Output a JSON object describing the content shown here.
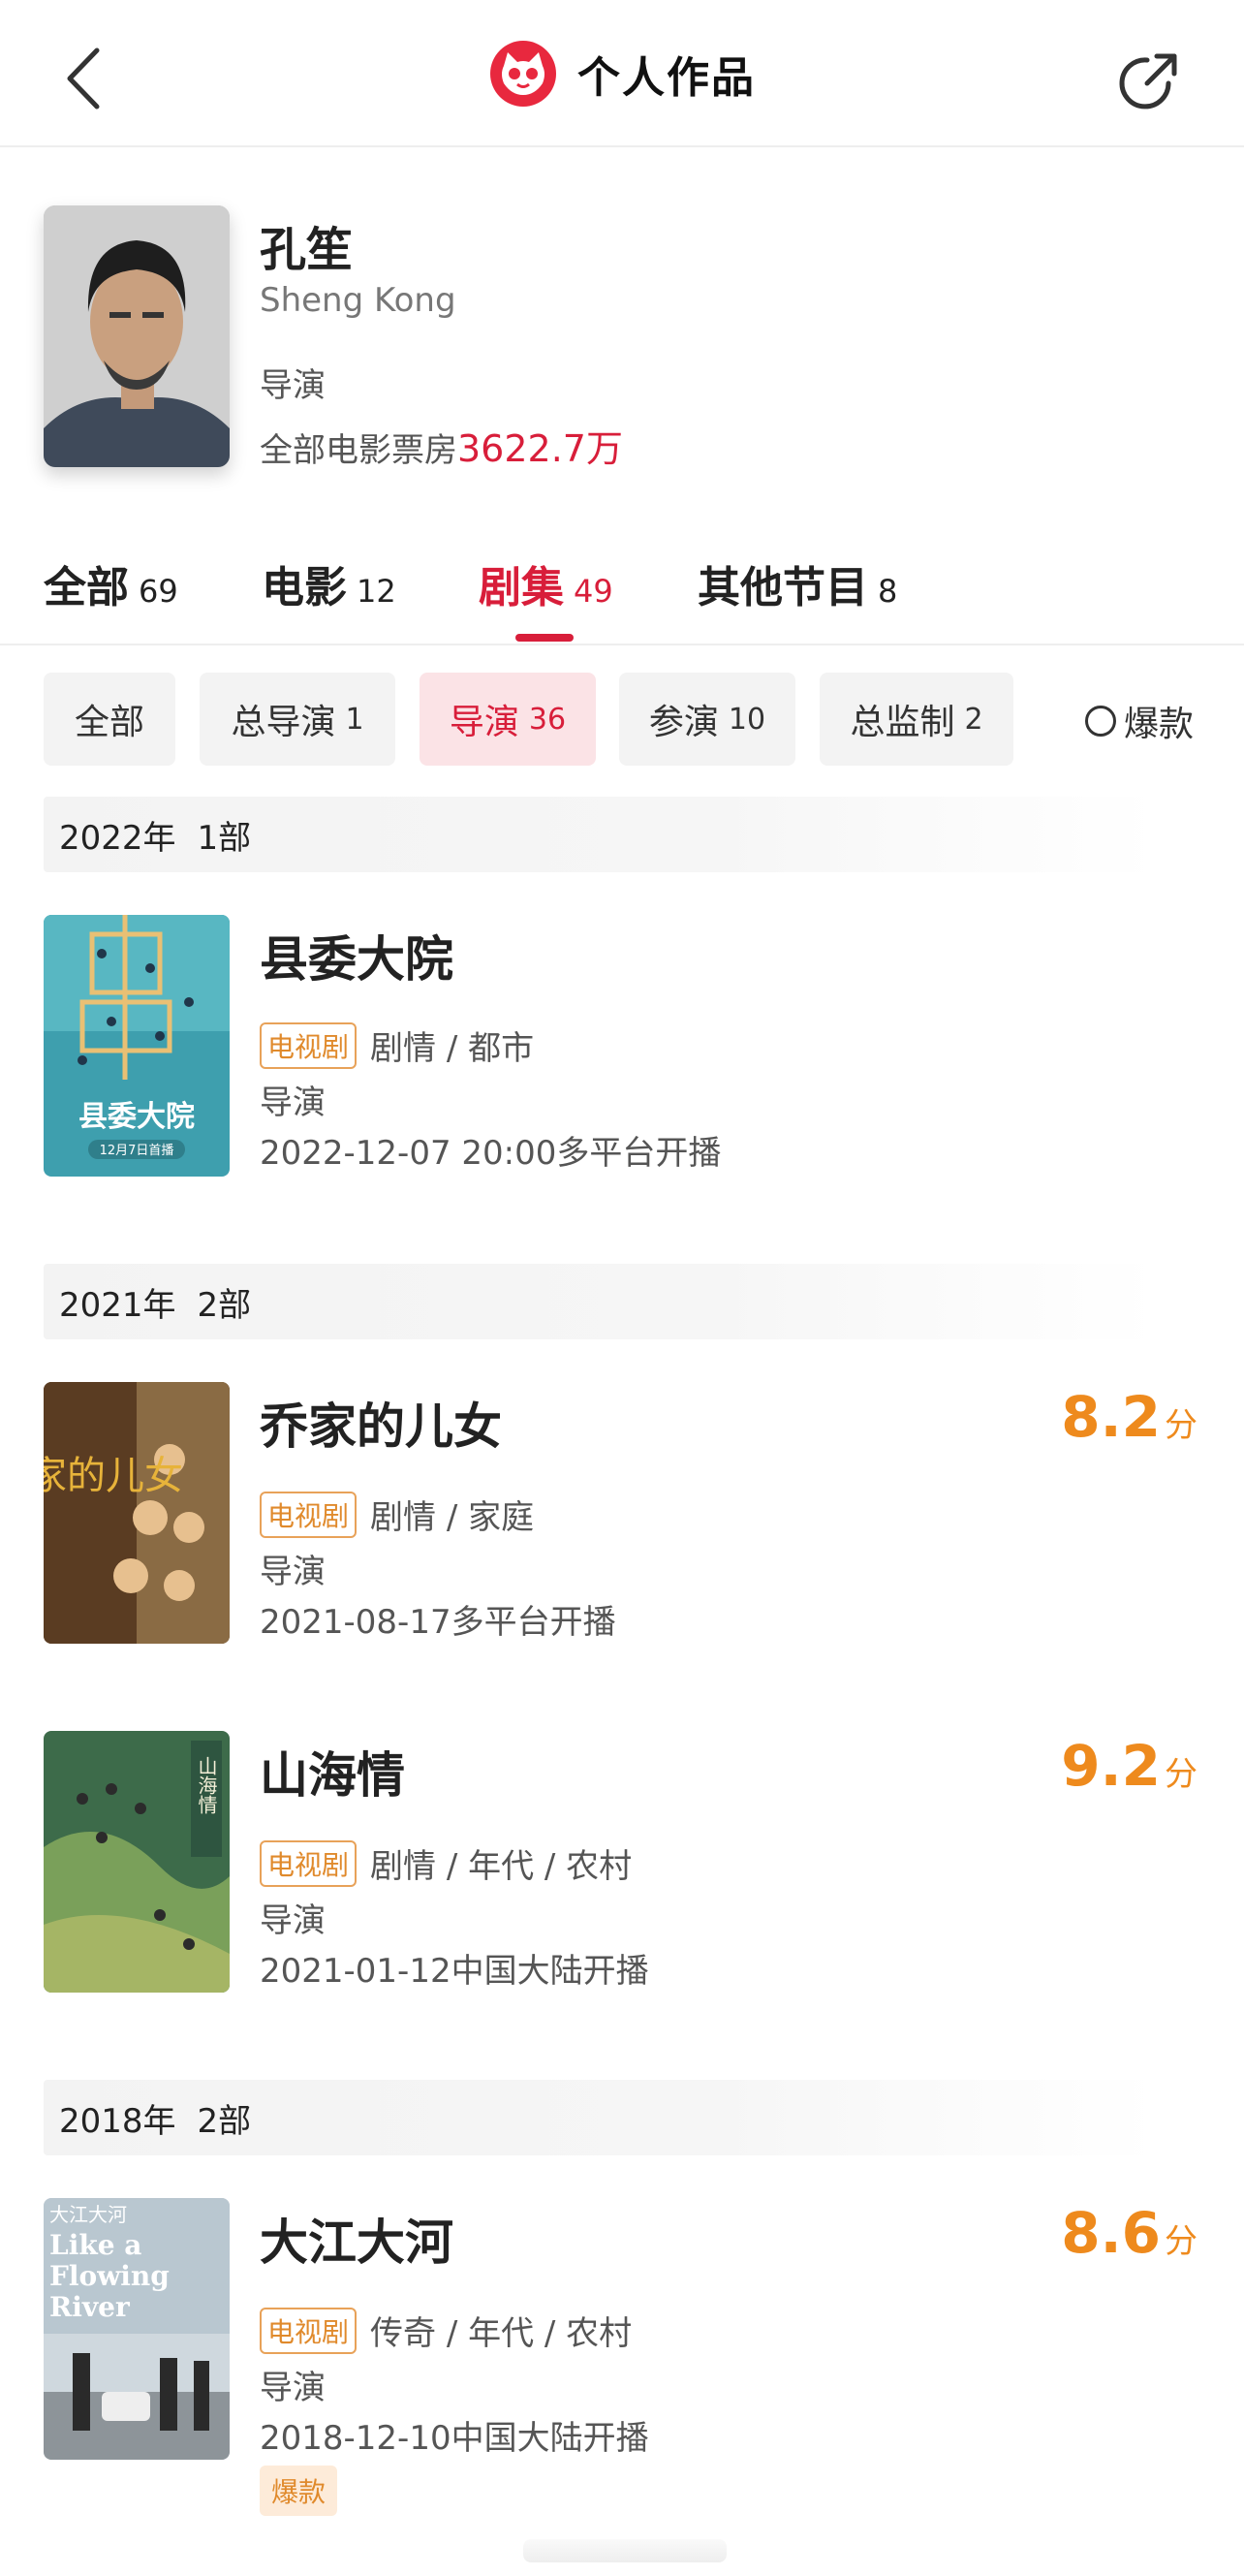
{
  "header": {
    "title": "个人作品",
    "back_icon": "chevron-left-icon",
    "share_icon": "share-icon",
    "logo_icon": "cat-logo-icon",
    "brand_color": "#e8283e"
  },
  "profile": {
    "name": "孔笙",
    "name_en": "Sheng Kong",
    "role": "导演",
    "boxoffice_label": "全部电影票房",
    "boxoffice_value": "3622.7万"
  },
  "tabs": [
    {
      "label": "全部",
      "count": "69"
    },
    {
      "label": "电影",
      "count": "12"
    },
    {
      "label": "剧集",
      "count": "49"
    },
    {
      "label": "其他节目",
      "count": "8"
    }
  ],
  "filters": [
    {
      "label": "全部",
      "count": ""
    },
    {
      "label": "总导演",
      "count": "1"
    },
    {
      "label": "导演",
      "count": "36"
    },
    {
      "label": "参演",
      "count": "10"
    },
    {
      "label": "总监制",
      "count": "2"
    }
  ],
  "hot_toggle": {
    "label": "爆款"
  },
  "groups": [
    {
      "year": "2022年",
      "count": "1部"
    },
    {
      "year": "2021年",
      "count": "2部"
    },
    {
      "year": "2018年",
      "count": "2部"
    }
  ],
  "items": [
    {
      "title": "县委大院",
      "type": "电视剧",
      "genres": "剧情 / 都市",
      "role": "导演",
      "release": "2022-12-07 20:00多平台开播",
      "score": "",
      "unit": "",
      "poster_text": "县委大院",
      "poster_sub": "12月7日首播"
    },
    {
      "title": "乔家的儿女",
      "type": "电视剧",
      "genres": "剧情 / 家庭",
      "role": "导演",
      "release": "2021-08-17多平台开播",
      "score": "8.2",
      "unit": "分",
      "poster_text": "乔家的儿女"
    },
    {
      "title": "山海情",
      "type": "电视剧",
      "genres": "剧情 / 年代 / 农村",
      "role": "导演",
      "release": "2021-01-12中国大陆开播",
      "score": "9.2",
      "unit": "分",
      "poster_text": "山海情"
    },
    {
      "title": "大江大河",
      "type": "电视剧",
      "genres": "传奇 / 年代 / 农村",
      "role": "导演",
      "release": "2018-12-10中国大陆开播",
      "score": "8.6",
      "unit": "分",
      "poster_text": "大江大河",
      "poster_en": [
        "Like a",
        "Flowing",
        "River"
      ],
      "badge": "爆款"
    }
  ]
}
